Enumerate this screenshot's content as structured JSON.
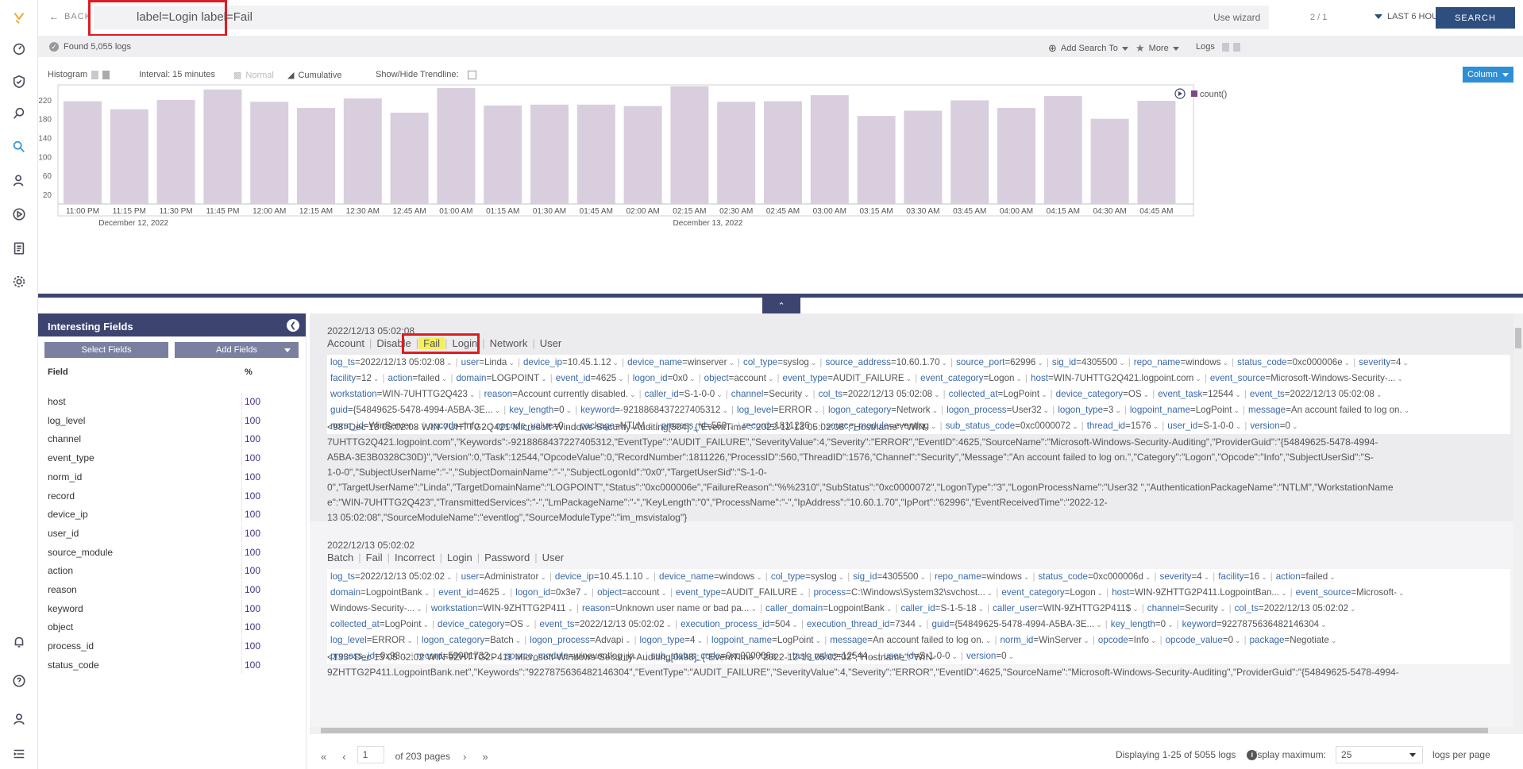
{
  "topbar": {
    "back_label": "BACK",
    "query": "label=Login label=Fail",
    "wizard": "Use wizard",
    "paging": "2 / 1",
    "timerange": "LAST 6 HOURS",
    "search": "SEARCH"
  },
  "foundbar": {
    "found": "Found 5,055 logs",
    "add_search_to": "Add Search To",
    "more": "More",
    "logs": "Logs"
  },
  "histctrl": {
    "histogram": "Histogram",
    "interval": "Interval: 15 minutes",
    "normal": "Normal",
    "cumulative": "Cumulative",
    "trendline": "Show/Hide Trendline:",
    "column": "Column"
  },
  "chart_data": {
    "type": "bar",
    "categories": [
      "11:00 PM",
      "11:15 PM",
      "11:30 PM",
      "11:45 PM",
      "12:00 AM",
      "12:15 AM",
      "12:30 AM",
      "12:45 AM",
      "01:00 AM",
      "01:15 AM",
      "01:30 AM",
      "01:45 AM",
      "02:00 AM",
      "02:15 AM",
      "02:30 AM",
      "02:45 AM",
      "03:00 AM",
      "03:15 AM",
      "03:30 AM",
      "03:45 AM",
      "04:00 AM",
      "04:15 AM",
      "04:30 AM",
      "04:45 AM"
    ],
    "values": [
      217,
      200,
      220,
      242,
      216,
      203,
      223,
      193,
      245,
      208,
      210,
      210,
      207,
      249,
      216,
      217,
      230,
      186,
      197,
      219,
      203,
      228,
      180,
      218
    ],
    "yticks": [
      20,
      60,
      100,
      140,
      180,
      220
    ],
    "ylim": [
      0,
      260
    ],
    "dates": [
      {
        "label": "December 12, 2022",
        "index": 1.5
      },
      {
        "label": "December 13, 2022",
        "index": 13.8
      }
    ],
    "legend": "count()",
    "bar_color": "#d9cedd",
    "grid": false
  },
  "fields": {
    "title": "Interesting Fields",
    "select_fields": "Select Fields",
    "add_fields": "Add Fields",
    "col_field": "Field",
    "col_pct": "%",
    "rows": [
      {
        "name": "host",
        "pct": "100"
      },
      {
        "name": "log_level",
        "pct": "100"
      },
      {
        "name": "channel",
        "pct": "100"
      },
      {
        "name": "event_type",
        "pct": "100"
      },
      {
        "name": "norm_id",
        "pct": "100"
      },
      {
        "name": "record",
        "pct": "100"
      },
      {
        "name": "device_ip",
        "pct": "100"
      },
      {
        "name": "user_id",
        "pct": "100"
      },
      {
        "name": "source_module",
        "pct": "100"
      },
      {
        "name": "action",
        "pct": "100"
      },
      {
        "name": "reason",
        "pct": "100"
      },
      {
        "name": "keyword",
        "pct": "100"
      },
      {
        "name": "object",
        "pct": "100"
      },
      {
        "name": "process_id",
        "pct": "100"
      },
      {
        "name": "status_code",
        "pct": "100"
      }
    ]
  },
  "logs": [
    {
      "timestamp": "2022/12/13 05:02:08",
      "labels": [
        "Account",
        "Disable",
        "Fail",
        "Login",
        "Network",
        "User"
      ],
      "kv_lines": [
        [
          [
            "log_ts",
            "2022/12/13 05:02:08"
          ],
          [
            "user",
            "Linda"
          ],
          [
            "device_ip",
            "10.45.1.12"
          ],
          [
            "device_name",
            "winserver"
          ],
          [
            "col_type",
            "syslog"
          ],
          [
            "source_address",
            "10.60.1.70"
          ],
          [
            "source_port",
            "62996"
          ],
          [
            "sig_id",
            "4305500"
          ],
          [
            "repo_name",
            "windows"
          ],
          [
            "status_code",
            "0xc000006e"
          ],
          [
            "severity",
            "4"
          ]
        ],
        [
          [
            "facility",
            "12"
          ],
          [
            "action",
            "failed"
          ],
          [
            "domain",
            "LOGPOINT"
          ],
          [
            "event_id",
            "4625"
          ],
          [
            "logon_id",
            "0x0"
          ],
          [
            "object",
            "account"
          ],
          [
            "event_type",
            "AUDIT_FAILURE"
          ],
          [
            "event_category",
            "Logon"
          ],
          [
            "host",
            "WIN-7UHTTG2Q421.logpoint.com"
          ],
          [
            "event_source",
            "Microsoft-Windows-Security-..."
          ]
        ],
        [
          [
            "workstation",
            "WIN-7UHTTG2Q423"
          ],
          [
            "reason",
            "Account currently disabled."
          ],
          [
            "caller_id",
            "S-1-0-0"
          ],
          [
            "channel",
            "Security"
          ],
          [
            "col_ts",
            "2022/12/13 05:02:08"
          ],
          [
            "collected_at",
            "LogPoint"
          ],
          [
            "device_category",
            "OS"
          ],
          [
            "event_task",
            "12544"
          ],
          [
            "event_ts",
            "2022/12/13 05:02:08"
          ]
        ],
        [
          [
            "guid",
            "{54849625-5478-4994-A5BA-3E..."
          ],
          [
            "key_length",
            "0"
          ],
          [
            "keyword",
            "-9218868437227405312"
          ],
          [
            "log_level",
            "ERROR"
          ],
          [
            "logon_category",
            "Network"
          ],
          [
            "logon_process",
            "User32"
          ],
          [
            "logon_type",
            "3"
          ],
          [
            "logpoint_name",
            "LogPoint"
          ],
          [
            "message",
            "An account failed to log on."
          ]
        ],
        [
          [
            "norm_id",
            "WinServer"
          ],
          [
            "opcode",
            "Info"
          ],
          [
            "opcode_value",
            "0"
          ],
          [
            "package",
            "NTLM"
          ],
          [
            "process_id",
            "560"
          ],
          [
            "record",
            "1811226"
          ],
          [
            "source_module",
            "eventlog"
          ],
          [
            "sub_status_code",
            "0xc0000072"
          ],
          [
            "thread_id",
            "1576"
          ],
          [
            "user_id",
            "S-1-0-0"
          ],
          [
            "version",
            "0"
          ]
        ]
      ],
      "raw": [
        "<98>Dec 13 05:02:08 WIN-7UHTTG2Q421 Microsoft-Windows-Security-Auditing[564]: {\"EventTime\":\"2022-12-13 05:02:08\",\"Hostname\":\"WIN-",
        "7UHTTG2Q421.logpoint.com\",\"Keywords\":-9218868437227405312,\"EventType\":\"AUDIT_FAILURE\",\"SeverityValue\":4,\"Severity\":\"ERROR\",\"EventID\":4625,\"SourceName\":\"Microsoft-Windows-Security-Auditing\",\"ProviderGuid\":\"{54849625-5478-4994-",
        "A5BA-3E3B0328C30D}\",\"Version\":0,\"Task\":12544,\"OpcodeValue\":0,\"RecordNumber\":1811226,\"ProcessID\":560,\"ThreadID\":1576,\"Channel\":\"Security\",\"Message\":\"An account failed to log on.\",\"Category\":\"Logon\",\"Opcode\":\"Info\",\"SubjectUserSid\":\"S-",
        "1-0-0\",\"SubjectUserName\":\"-\",\"SubjectDomainName\":\"-\",\"SubjectLogonId\":\"0x0\",\"TargetUserSid\":\"S-1-0-",
        "0\",\"TargetUserName\":\"Linda\",\"TargetDomainName\":\"LOGPOINT\",\"Status\":\"0xc000006e\",\"FailureReason\":\"%%2310\",\"SubStatus\":\"0xc0000072\",\"LogonType\":\"3\",\"LogonProcessName\":\"User32 \",\"AuthenticationPackageName\":\"NTLM\",\"WorkstationName",
        "e\":\"WIN-7UHTTG2Q423\",\"TransmittedServices\":\"-\",\"LmPackageName\":\"-\",\"KeyLength\":\"0\",\"ProcessName\":\"-\",\"IpAddress\":\"10.60.1.70\",\"IpPort\":\"62996\",\"EventReceivedTime\":\"2022-12-",
        "13 05:02:08\",\"SourceModuleName\":\"eventlog\",\"SourceModuleType\":\"im_msvistalog\"}"
      ]
    },
    {
      "timestamp": "2022/12/13 05:02:02",
      "labels": [
        "Batch",
        "Fail",
        "Incorrect",
        "Login",
        "Password",
        "User"
      ],
      "kv_lines": [
        [
          [
            "log_ts",
            "2022/12/13 05:02:02"
          ],
          [
            "user",
            "Administrator"
          ],
          [
            "device_ip",
            "10.45.1.10"
          ],
          [
            "device_name",
            "windows"
          ],
          [
            "col_type",
            "syslog"
          ],
          [
            "sig_id",
            "4305500"
          ],
          [
            "repo_name",
            "windows"
          ],
          [
            "status_code",
            "0xc000006d"
          ],
          [
            "severity",
            "4"
          ],
          [
            "facility",
            "16"
          ],
          [
            "action",
            "failed"
          ]
        ],
        [
          [
            "domain",
            "LogpointBank"
          ],
          [
            "event_id",
            "4625"
          ],
          [
            "logon_id",
            "0x3e7"
          ],
          [
            "object",
            "account"
          ],
          [
            "event_type",
            "AUDIT_FAILURE"
          ],
          [
            "process",
            "C:\\Windows\\System32\\svchost..."
          ],
          [
            "event_category",
            "Logon"
          ],
          [
            "host",
            "WIN-9ZHTTG2P411.LogpointBan..."
          ],
          [
            "event_source",
            "Microsoft-"
          ]
        ],
        [
          [
            "",
            "Windows-Security-..."
          ],
          [
            "workstation",
            "WIN-9ZHTTG2P411"
          ],
          [
            "reason",
            "Unknown user name or bad pa..."
          ],
          [
            "caller_domain",
            "LogpointBank"
          ],
          [
            "caller_id",
            "S-1-5-18"
          ],
          [
            "caller_user",
            "WIN-9ZHTTG2P411$"
          ],
          [
            "channel",
            "Security"
          ],
          [
            "col_ts",
            "2022/12/13 05:02:02"
          ]
        ],
        [
          [
            "collected_at",
            "LogPoint"
          ],
          [
            "device_category",
            "OS"
          ],
          [
            "event_ts",
            "2022/12/13 05:02:02"
          ],
          [
            "execution_process_id",
            "504"
          ],
          [
            "execution_thread_id",
            "7344"
          ],
          [
            "guid",
            "{54849625-5478-4994-A5BA-3E..."
          ],
          [
            "key_length",
            "0"
          ],
          [
            "keyword",
            "9227875636482146304"
          ]
        ],
        [
          [
            "log_level",
            "ERROR"
          ],
          [
            "logon_category",
            "Batch"
          ],
          [
            "logon_process",
            "Advapi"
          ],
          [
            "logon_type",
            "4"
          ],
          [
            "logpoint_name",
            "LogPoint"
          ],
          [
            "message",
            "An account failed to log on."
          ],
          [
            "norm_id",
            "WinServer"
          ],
          [
            "opcode",
            "Info"
          ],
          [
            "opcode_value",
            "0"
          ],
          [
            "package",
            "Negotiate"
          ]
        ],
        [
          [
            "process_id",
            "0x98"
          ],
          [
            "record",
            "59001732"
          ],
          [
            "source_module",
            "wineventlog_in"
          ],
          [
            "sub_status_code",
            "0xc000006a"
          ],
          [
            "task_value",
            "12544"
          ],
          [
            "user_id",
            "S-1-0-0"
          ],
          [
            "version",
            "0"
          ]
        ]
      ],
      "raw": [
        "<133>Dec 13 05:02:02 WIN-9ZHTTG2P411 Microsoft-Windows-Security-Auditing[0x98]: {\"EventTime\":\"2022-12-13 05:02:02\",\"Hostname\":\"WIN-",
        "9ZHTTG2P411.LogpointBank.net\",\"Keywords\":\"9227875636482146304\",\"EventType\":\"AUDIT_FAILURE\",\"SeverityValue\":4,\"Severity\":\"ERROR\",\"EventID\":4625,\"SourceName\":\"Microsoft-Windows-Security-Auditing\",\"ProviderGuid\":\"{54849625-5478-4994-"
      ]
    }
  ],
  "pager": {
    "page": "1",
    "of_pages": "of 203 pages",
    "displaying": "Displaying 1-25 of 5055 logs",
    "display_max_label": "Display maximum:",
    "display_max": "25",
    "per_page": "logs per page"
  }
}
